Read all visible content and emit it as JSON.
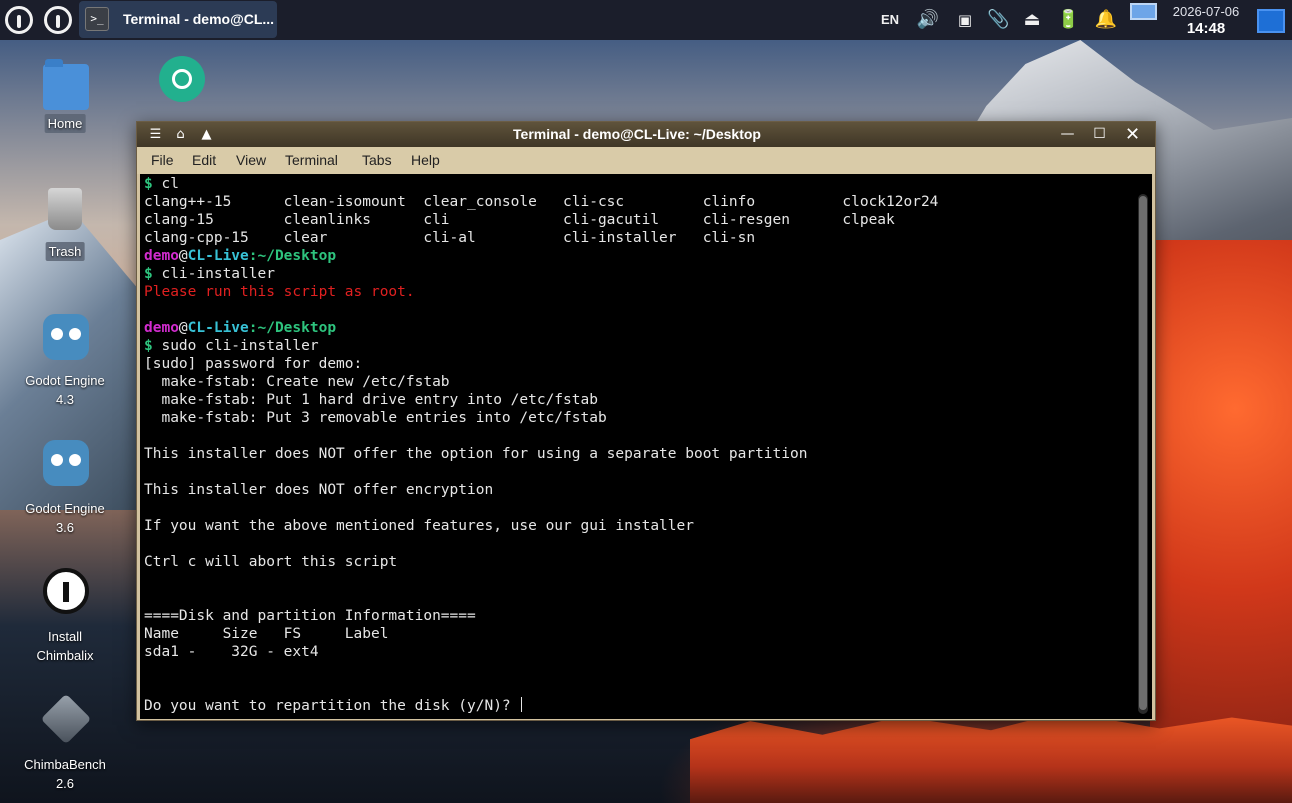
{
  "panel": {
    "task_label": "Terminal - demo@CL...",
    "language": "EN",
    "date": "2026-07-06",
    "time": "14:48"
  },
  "desktop": {
    "icons": [
      {
        "label": "Home"
      },
      {
        "label": "Trash"
      },
      {
        "label": "Godot Engine\n4.3"
      },
      {
        "label": "Godot Engine\n3.6"
      },
      {
        "label": "Install\nChimbalix"
      },
      {
        "label": "ChimbaBench\n2.6"
      }
    ]
  },
  "window": {
    "title": "Terminal - demo@CL-Live: ~/Desktop",
    "menu": [
      "File",
      "Edit",
      "View",
      "Terminal",
      "Tabs",
      "Help"
    ]
  },
  "terminal": {
    "prompt_user": "demo",
    "prompt_at": "@",
    "prompt_host": "CL-Live",
    "prompt_path": ":~/Desktop",
    "prompt_symbol": "$",
    "cmd1": "cl",
    "completions": [
      "clang++-15      clean-isomount  clear_console   cli-csc         clinfo          clock12or24",
      "clang-15        cleanlinks      cli             cli-gacutil     cli-resgen      clpeak",
      "clang-cpp-15    clear           cli-al          cli-installer   cli-sn"
    ],
    "cmd2": "cli-installer",
    "error": "Please run this script as root.",
    "cmd3": "sudo cli-installer",
    "output": "[sudo] password for demo:\n  make-fstab: Create new /etc/fstab\n  make-fstab: Put 1 hard drive entry into /etc/fstab\n  make-fstab: Put 3 removable entries into /etc/fstab\n\nThis installer does NOT offer the option for using a separate boot partition\n\nThis installer does NOT offer encryption\n\nIf you want the above mentioned features, use our gui installer\n\nCtrl c will abort this script\n\n\n====Disk and partition Information====\nName     Size   FS     Label\nsda1 -    32G - ext4\n\n\n",
    "question": "Do you want to repartition the disk (y/N)? "
  }
}
